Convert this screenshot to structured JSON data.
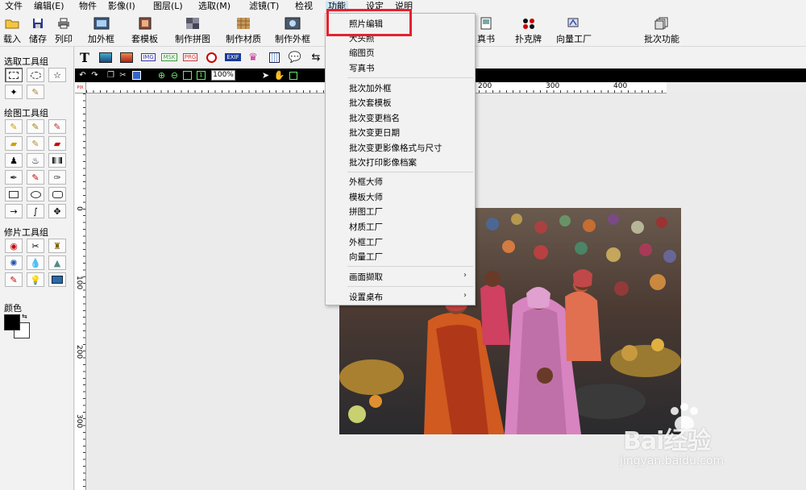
{
  "menubar": {
    "items": [
      "文件",
      "编辑(E)",
      "物件",
      "影像(I)",
      "图层(L)",
      "选取(M)",
      "滤镜(T)",
      "检视",
      "功能",
      "设定",
      "说明"
    ],
    "active_index": 8
  },
  "toolbar": {
    "items": [
      {
        "label": "载入",
        "icon": "folder-open-icon"
      },
      {
        "label": "储存",
        "icon": "floppy-disk-icon"
      },
      {
        "label": "列印",
        "icon": "printer-icon"
      },
      {
        "label": "加外框",
        "icon": "frame-icon"
      },
      {
        "label": "套模板",
        "icon": "template-icon"
      },
      {
        "label": "制作拼图",
        "icon": "collage-icon"
      },
      {
        "label": "制作材质",
        "icon": "texture-icon"
      },
      {
        "label": "制作外框",
        "icon": "make-frame-icon"
      },
      {
        "label": "真书",
        "icon": "photo-book-icon"
      },
      {
        "label": "扑克牌",
        "icon": "poker-icon"
      },
      {
        "label": "向量工厂",
        "icon": "vector-factory-icon"
      },
      {
        "label": "批次功能",
        "icon": "batch-icon"
      }
    ]
  },
  "left_panel": {
    "select_group_title": "选取工具组",
    "draw_group_title": "绘图工具组",
    "retouch_group_title": "修片工具组",
    "color_title": "颜色",
    "foreground_color": "#000000",
    "background_color": "#ffffff"
  },
  "toolbar2": {
    "icons": [
      "text-tool-icon",
      "image-insert-icon",
      "frame-insert-icon",
      "img-icon",
      "msk-icon",
      "prg-icon",
      "clock-icon",
      "exif-icon",
      "cake-icon",
      "calendar-icon",
      "speech-bubble-icon",
      "arrow-icon"
    ],
    "img_label": "IMG",
    "msk_label": "MSK",
    "prg_label": "PRG",
    "exif_label": "EXIF"
  },
  "navbar": {
    "zoom": "100%"
  },
  "rulers": {
    "top_labels": [
      "200",
      "300",
      "400"
    ],
    "left_labels": [
      "0",
      "100",
      "200",
      "300"
    ]
  },
  "dropdown": {
    "items": [
      {
        "label": "照片编辑"
      },
      {
        "label": "大头照"
      },
      {
        "label": "缩图页"
      },
      {
        "label": "写真书"
      },
      {
        "label": "批次加外框"
      },
      {
        "label": "批次套模板"
      },
      {
        "label": "批次变更档名"
      },
      {
        "label": "批次变更日期"
      },
      {
        "label": "批次变更影像格式与尺寸"
      },
      {
        "label": "批次打印影像档案"
      },
      {
        "label": "外框大师"
      },
      {
        "label": "模板大师"
      },
      {
        "label": "拼图工厂"
      },
      {
        "label": "材质工厂"
      },
      {
        "label": "外框工厂"
      },
      {
        "label": "向量工厂"
      },
      {
        "label": "画面撷取"
      },
      {
        "label": "设置桌布"
      }
    ],
    "highlight_color": "#e5222f"
  },
  "watermark": {
    "brand": "Bai经验",
    "url": "jingyan.baidu.com"
  }
}
